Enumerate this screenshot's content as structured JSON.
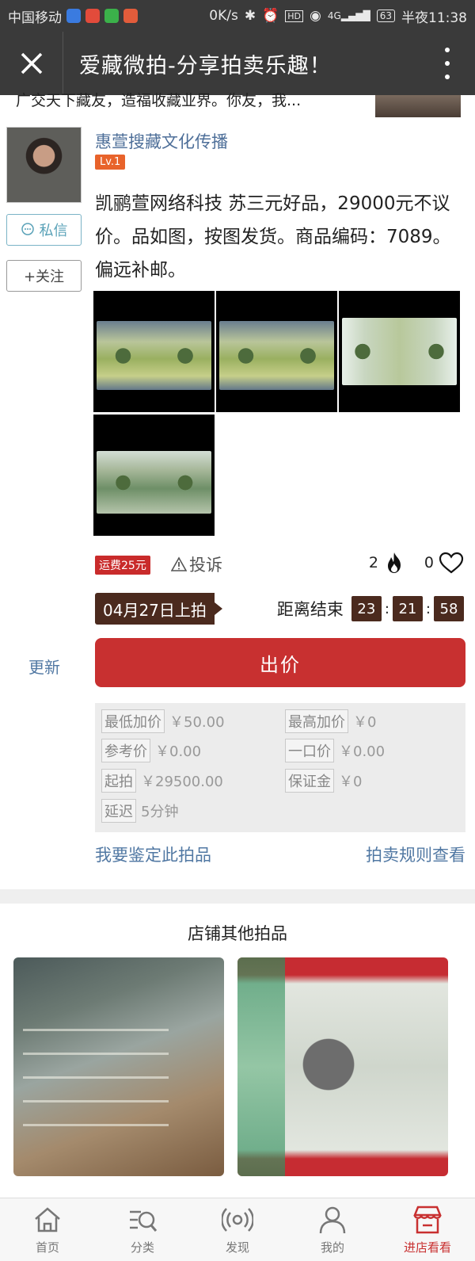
{
  "status_bar": {
    "carrier": "中国移动",
    "net_speed": "0K/s",
    "network": "4G",
    "battery": "63",
    "time": "半夜11:38"
  },
  "header": {
    "title": "爱藏微拍-分享拍卖乐趣！"
  },
  "prev_post": {
    "text": "广交天下藏友，造福收藏业界。你友，我..."
  },
  "seller": {
    "name": "惠萱搜藏文化传播",
    "level": "Lv.1",
    "message_label": "私信",
    "follow_label": "+关注"
  },
  "post": {
    "description": "凯鹂萱网络科技 苏三元好品，29000元不议价。品如图，按图发货。商品编码：7089。偏远补邮。",
    "shipping_badge": "运费25元",
    "complain_label": "投诉",
    "heat_count": "2",
    "like_count": "0"
  },
  "auction": {
    "start_date": "04月27日上拍",
    "countdown_label": "距离结束",
    "hours": "23",
    "minutes": "21",
    "seconds": "58",
    "separator": ":",
    "refresh_label": "更新",
    "bid_label": "出价"
  },
  "info": {
    "min_increment_label": "最低加价",
    "min_increment_value": "￥50.00",
    "max_increment_label": "最高加价",
    "max_increment_value": "￥0",
    "ref_price_label": "参考价",
    "ref_price_value": "￥0.00",
    "buyout_label": "一口价",
    "buyout_value": "￥0.00",
    "start_price_label": "起拍",
    "start_price_value": "￥29500.00",
    "deposit_label": "保证金",
    "deposit_value": "￥0",
    "delay_label": "延迟",
    "delay_value": "5分钟"
  },
  "links": {
    "appraise": "我要鉴定此拍品",
    "rules": "拍卖规则查看"
  },
  "shop": {
    "title": "店铺其他拍品"
  },
  "bottom_nav": [
    {
      "label": "首页",
      "icon": "home-icon"
    },
    {
      "label": "分类",
      "icon": "category-search-icon"
    },
    {
      "label": "发现",
      "icon": "discover-icon"
    },
    {
      "label": "我的",
      "icon": "user-icon"
    },
    {
      "label": "进店看看",
      "icon": "store-icon"
    }
  ],
  "colors": {
    "accent_red": "#c83030",
    "link_blue": "#5178a3",
    "dark_brown": "#4b2a1e",
    "status_bar": "#3a3a3a"
  }
}
